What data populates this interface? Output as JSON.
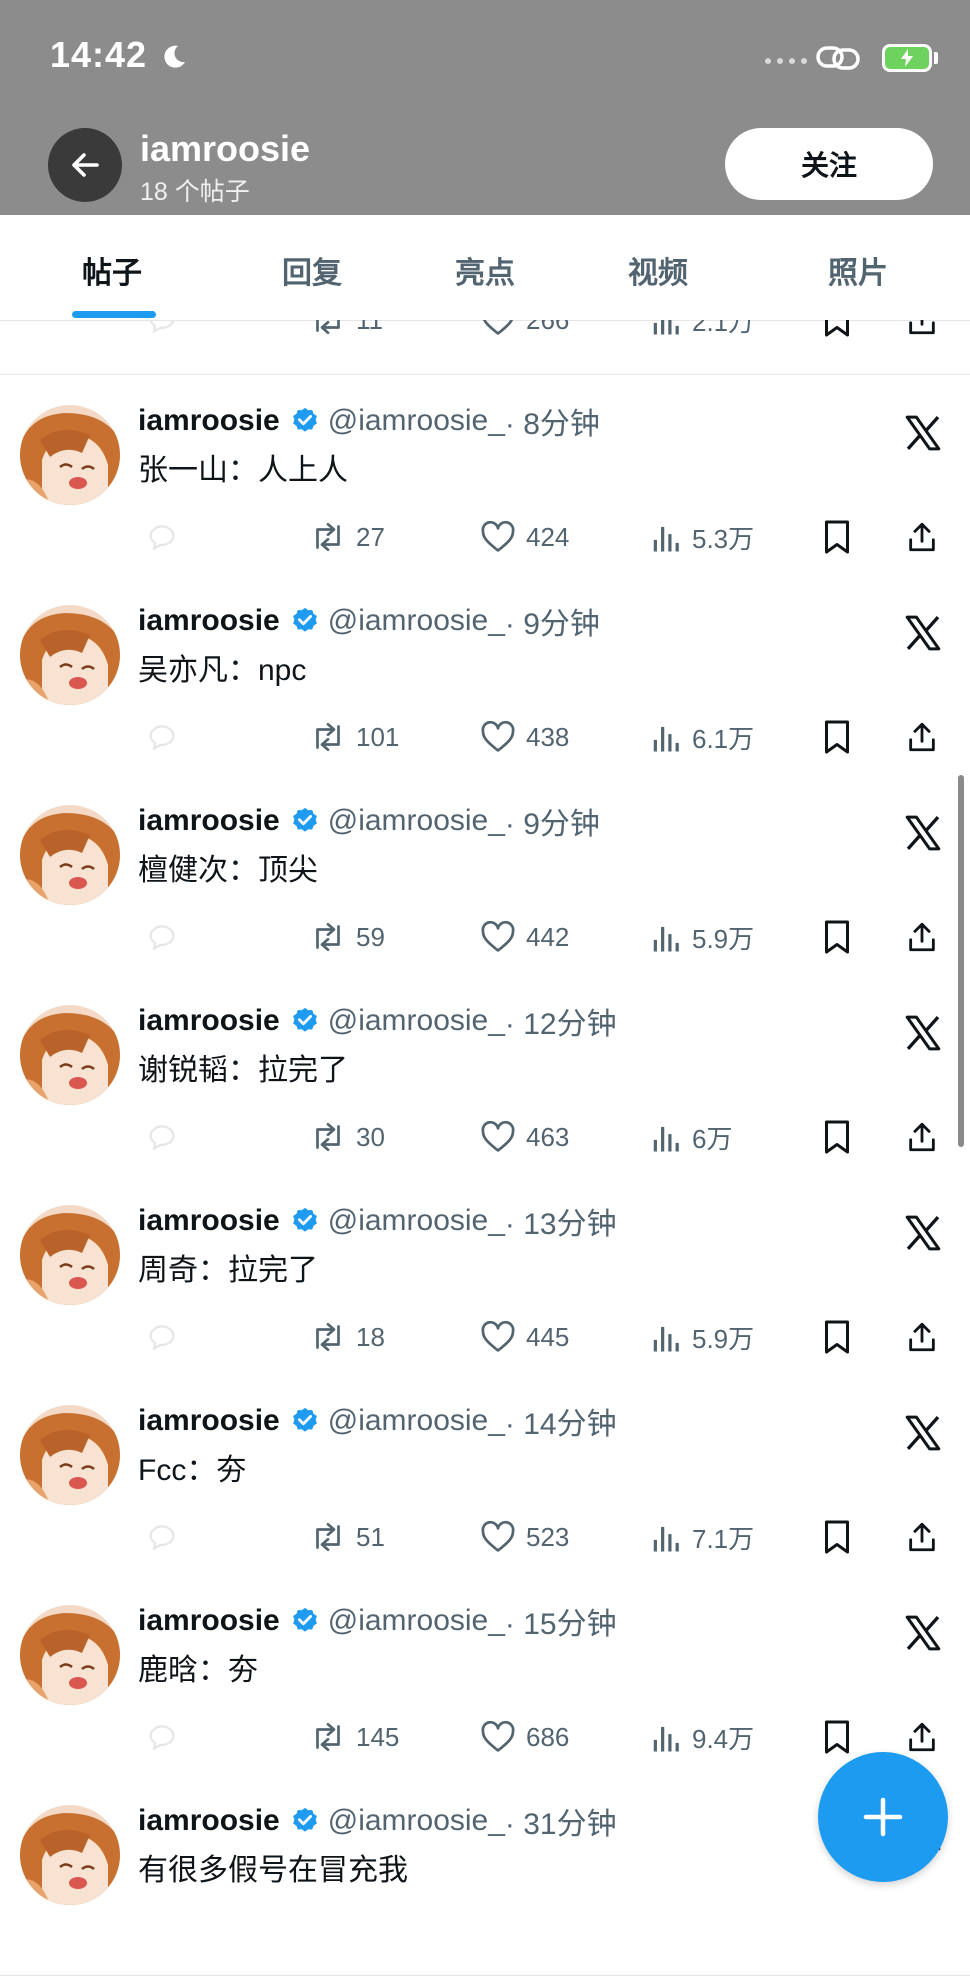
{
  "status_bar": {
    "time": "14:42"
  },
  "header": {
    "name": "iamroosie",
    "post_count": "18 个帖子",
    "follow_label": "关注"
  },
  "tabs": [
    {
      "label": "帖子",
      "active": true
    },
    {
      "label": "回复",
      "active": false
    },
    {
      "label": "亮点",
      "active": false
    },
    {
      "label": "视频",
      "active": false
    },
    {
      "label": "照片",
      "active": false
    }
  ],
  "partial_post": {
    "retweets": "11",
    "likes": "266",
    "views": "2.1万"
  },
  "posts": [
    {
      "name": "iamroosie",
      "handle": "@iamroosie_",
      "time": "· 8分钟",
      "text": "张一山：人上人",
      "retweets": "27",
      "likes": "424",
      "views": "5.3万"
    },
    {
      "name": "iamroosie",
      "handle": "@iamroosie_",
      "time": "· 9分钟",
      "text": "吴亦凡：npc",
      "retweets": "101",
      "likes": "438",
      "views": "6.1万"
    },
    {
      "name": "iamroosie",
      "handle": "@iamroosie_",
      "time": "· 9分钟",
      "text": "檀健次：顶尖",
      "retweets": "59",
      "likes": "442",
      "views": "5.9万"
    },
    {
      "name": "iamroosie",
      "handle": "@iamroosie_",
      "time": "· 12分钟",
      "text": "谢锐韬：拉完了",
      "retweets": "30",
      "likes": "463",
      "views": "6万"
    },
    {
      "name": "iamroosie",
      "handle": "@iamroosie_",
      "time": "· 13分钟",
      "text": "周奇：拉完了",
      "retweets": "18",
      "likes": "445",
      "views": "5.9万"
    },
    {
      "name": "iamroosie",
      "handle": "@iamroosie_",
      "time": "· 14分钟",
      "text": "Fcc：夯",
      "retweets": "51",
      "likes": "523",
      "views": "7.1万"
    },
    {
      "name": "iamroosie",
      "handle": "@iamroosie_",
      "time": "· 15分钟",
      "text": "鹿晗：夯",
      "retweets": "145",
      "likes": "686",
      "views": "9.4万"
    },
    {
      "name": "iamroosie",
      "handle": "@iamroosie_",
      "time": "· 31分钟",
      "text": "有很多假号在冒充我"
    }
  ],
  "colors": {
    "accent": "#1d9bf0",
    "text": "#0f1419",
    "muted": "#536471",
    "verified": "#1d9bf0"
  }
}
